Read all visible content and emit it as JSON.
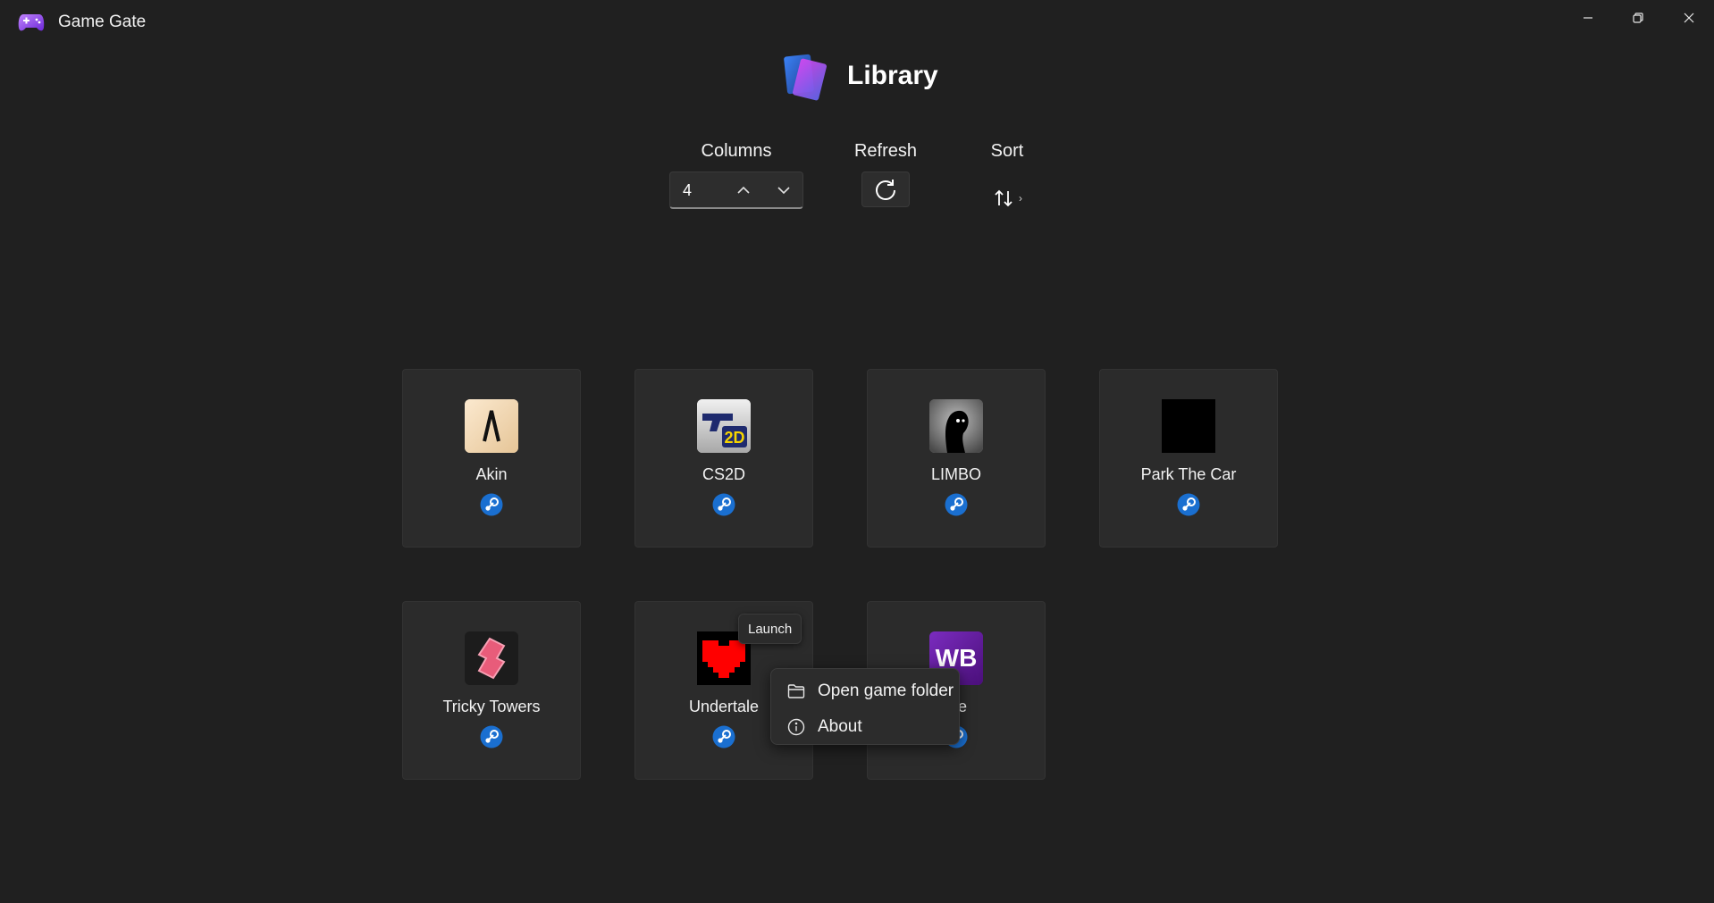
{
  "window": {
    "title": "Game Gate",
    "controls": [
      "minimize-icon",
      "restore-icon",
      "close-icon"
    ]
  },
  "header": {
    "title": "Library"
  },
  "controls": {
    "columns_label": "Columns",
    "columns_value": "4",
    "refresh_label": "Refresh",
    "sort_label": "Sort"
  },
  "games": [
    {
      "name": "Akin",
      "icon": "akin-icon",
      "platform": "steam-icon"
    },
    {
      "name": "CS2D",
      "icon": "cs2d-icon",
      "platform": "steam-icon"
    },
    {
      "name": "LIMBO",
      "icon": "limbo-icon",
      "platform": "steam-icon"
    },
    {
      "name": "Park The Car",
      "icon": "park-the-car-icon",
      "platform": "steam-icon"
    },
    {
      "name": "Tricky Towers",
      "icon": "tricky-towers-icon",
      "platform": "steam-icon"
    },
    {
      "name": "Undertale",
      "icon": "undertale-icon",
      "platform": "steam-icon"
    },
    {
      "name": "ble",
      "icon": "wb-icon",
      "icon_text": "WB",
      "platform": "steam-icon"
    }
  ],
  "tooltip": {
    "text": "Launch"
  },
  "context_menu": {
    "items": [
      {
        "label": "Open game folder",
        "icon": "folder-icon"
      },
      {
        "label": "About",
        "icon": "info-icon"
      }
    ]
  },
  "colors": {
    "background": "#202020",
    "card": "#2b2b2b",
    "steam_blue": "#1a6fd0",
    "accent_purple": "#8b5cf6"
  }
}
